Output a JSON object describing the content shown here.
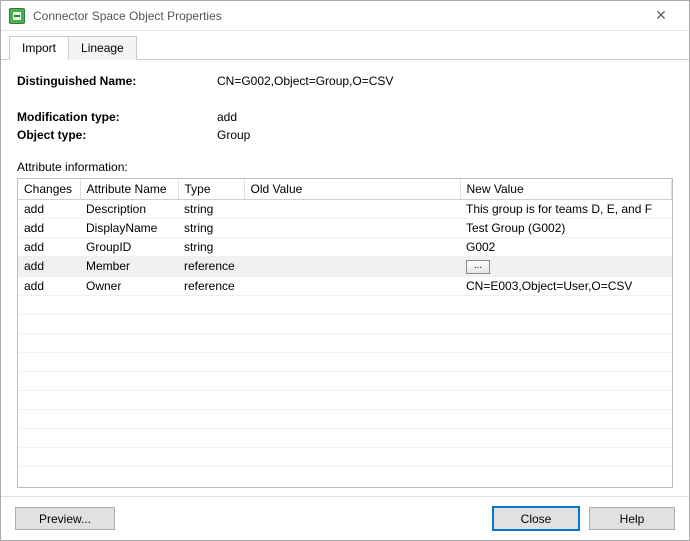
{
  "window": {
    "title": "Connector Space Object Properties"
  },
  "tabs": {
    "import": "Import",
    "lineage": "Lineage"
  },
  "labels": {
    "dn": "Distinguished Name:",
    "modtype": "Modification type:",
    "objtype": "Object type:",
    "attrinfo": "Attribute information:"
  },
  "values": {
    "dn": "CN=G002,Object=Group,O=CSV",
    "modtype": "add",
    "objtype": "Group"
  },
  "columns": {
    "changes": "Changes",
    "attrname": "Attribute Name",
    "type": "Type",
    "oldval": "Old Value",
    "newval": "New Value"
  },
  "rows": [
    {
      "changes": "add",
      "attr": "Description",
      "type": "string",
      "old": "",
      "new": "This group is for teams D, E, and F",
      "btn": false,
      "sel": false
    },
    {
      "changes": "add",
      "attr": "DisplayName",
      "type": "string",
      "old": "",
      "new": "Test Group (G002)",
      "btn": false,
      "sel": false
    },
    {
      "changes": "add",
      "attr": "GroupID",
      "type": "string",
      "old": "",
      "new": "G002",
      "btn": false,
      "sel": false
    },
    {
      "changes": "add",
      "attr": "Member",
      "type": "reference",
      "old": "",
      "new": "",
      "btn": true,
      "sel": true
    },
    {
      "changes": "add",
      "attr": "Owner",
      "type": "reference",
      "old": "",
      "new": "CN=E003,Object=User,O=CSV",
      "btn": false,
      "sel": false
    }
  ],
  "buttons": {
    "preview": "Preview...",
    "close": "Close",
    "help": "Help",
    "ellipsis": "..."
  }
}
